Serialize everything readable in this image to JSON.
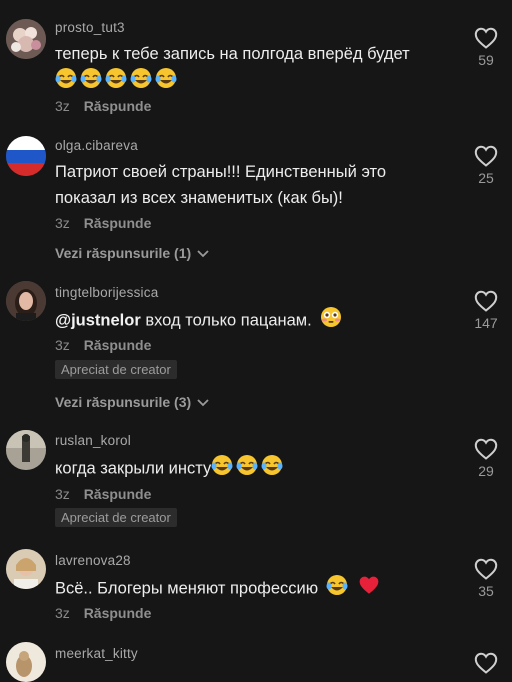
{
  "comments": [
    {
      "username": "prosto_tut3",
      "text": "теперь к тебе запись на полгода вперёд будет",
      "age": "3z",
      "reply_label": "Răspunde",
      "likes": "59",
      "trailing_emoji": "laugh-cry-emoji",
      "trailing_emoji_count": 5
    },
    {
      "username": "olga.cibareva",
      "text": "Патриот своей страны!!! Единственный это показал из всех знаменитых (как бы)!",
      "age": "3z",
      "reply_label": "Răspunde",
      "likes": "25",
      "view_replies": "Vezi răspunsurile (1)"
    },
    {
      "username": "tingtelborijessica",
      "mention": "@justnelor",
      "text": " вход только пацанам.",
      "age": "3z",
      "reply_label": "Răspunde",
      "likes": "147",
      "badge": "Apreciat de creator",
      "view_replies": "Vezi răspunsurile (3)",
      "trailing_emoji": "flushed-emoji"
    },
    {
      "username": "ruslan_korol",
      "text": "когда закрыли инсту",
      "age": "3z",
      "reply_label": "Răspunde",
      "likes": "29",
      "badge": "Apreciat de creator",
      "trailing_emoji": "laugh-cry-emoji",
      "trailing_emoji_count": 3
    },
    {
      "username": "lavrenova28",
      "text": "Всё.. Блогеры меняют профессию",
      "age": "3z",
      "reply_label": "Răspunde",
      "likes": "35",
      "trailing_emoji": "laugh-cry-emoji + red-heart-emoji"
    },
    {
      "username": "meerkat_kitty"
    }
  ],
  "colors": {
    "background": "#161616",
    "username": "#a9a9a9",
    "text": "#ededed",
    "muted": "#8a8a8a",
    "heart_red": "#e8213b",
    "emoji_yellow": "#f7c52e"
  }
}
